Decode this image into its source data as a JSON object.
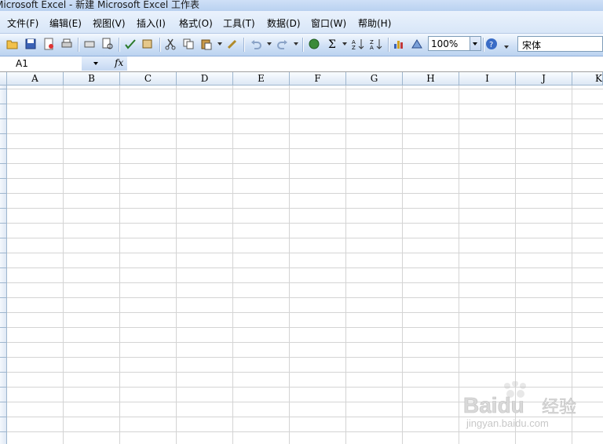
{
  "window": {
    "title": "Microsoft Excel - 新建 Microsoft Excel 工作表"
  },
  "menu": {
    "items": [
      "文件(F)",
      "编辑(E)",
      "视图(V)",
      "插入(I)",
      "格式(O)",
      "工具(T)",
      "数据(D)",
      "窗口(W)",
      "帮助(H)"
    ]
  },
  "toolbar": {
    "zoom": "100%",
    "font_name": "宋体",
    "icons": [
      "open-icon",
      "save-icon",
      "permission-icon",
      "print-icon",
      "print-preview-icon",
      "spelling-icon",
      "research-icon",
      "cut-icon",
      "copy-icon",
      "paste-icon",
      "format-painter-icon",
      "undo-icon",
      "redo-icon",
      "hyperlink-icon",
      "autosum-icon",
      "sort-ascending-icon",
      "sort-descending-icon",
      "chart-wizard-icon",
      "drawing-icon",
      "help-icon"
    ]
  },
  "formula_bar": {
    "name_box": "A1",
    "fx": "fx",
    "formula": ""
  },
  "sheet": {
    "columns": [
      "A",
      "B",
      "C",
      "D",
      "E",
      "F",
      "G",
      "H",
      "I",
      "J",
      "K"
    ]
  },
  "watermark": {
    "brand": "Baidu",
    "sub1": "经验",
    "sub2": "jingyan.baidu.com"
  },
  "colors": {
    "menu_bg": "#dbe7f8",
    "toolbar_bg": "#c7dbf3",
    "gridline": "#d4d4d4",
    "header_bg": "#e8eff8"
  }
}
